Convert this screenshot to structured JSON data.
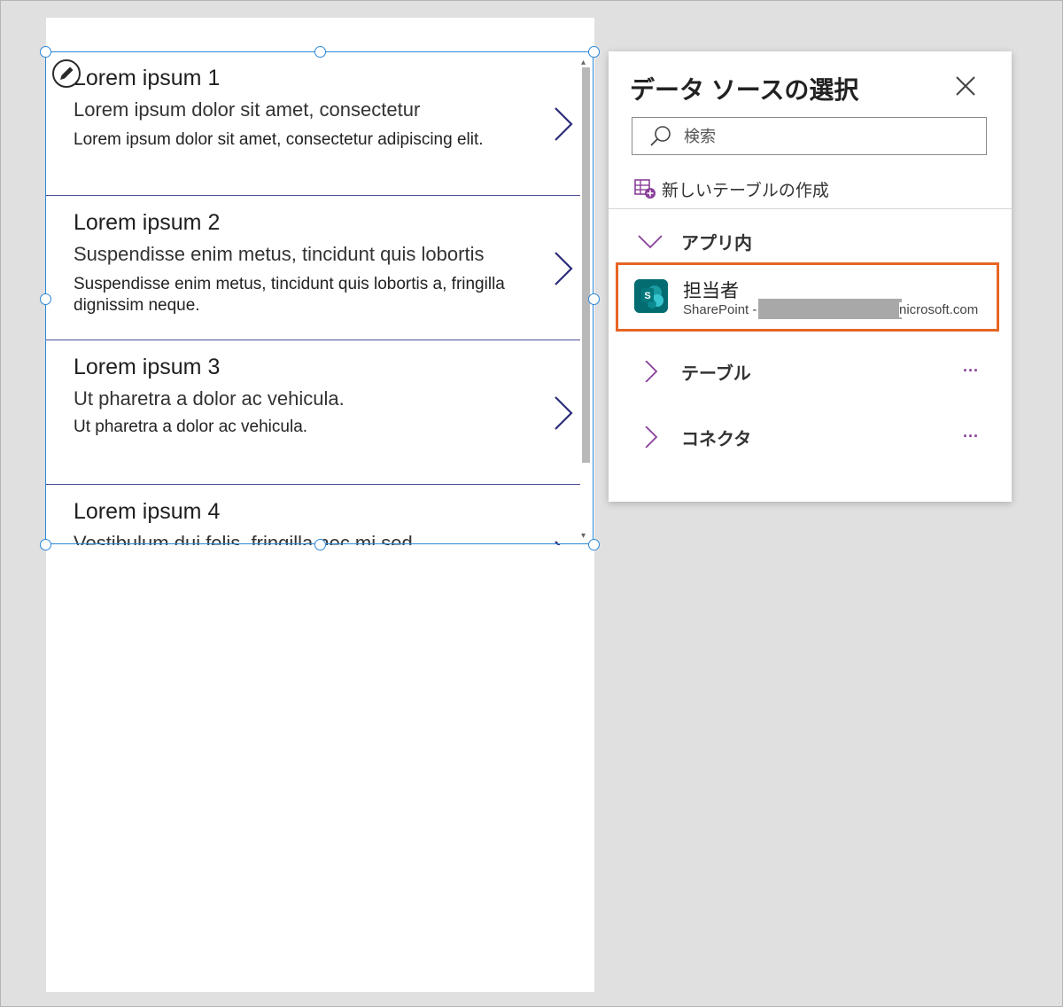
{
  "gallery": {
    "items": [
      {
        "title": "Lorem ipsum 1",
        "subtitle": "Lorem ipsum dolor sit amet, consectetur",
        "body": "Lorem ipsum dolor sit amet, consectetur adipiscing elit."
      },
      {
        "title": "Lorem ipsum 2",
        "subtitle": "Suspendisse enim metus, tincidunt quis lobortis",
        "body": "Suspendisse enim metus, tincidunt quis lobortis a, fringilla dignissim neque."
      },
      {
        "title": "Lorem ipsum 3",
        "subtitle": "Ut pharetra a dolor ac vehicula.",
        "body": "Ut pharetra a dolor ac vehicula."
      },
      {
        "title": "Lorem ipsum 4",
        "subtitle": "Vestibulum dui felis, fringilla nec mi sed",
        "body": ""
      }
    ]
  },
  "panel": {
    "title": "データ ソースの選択",
    "search_placeholder": "検索",
    "create_table_label": "新しいテーブルの作成",
    "sections": {
      "in_app": "アプリ内",
      "tables": "テーブル",
      "connectors": "コネクタ"
    },
    "more_label": "...",
    "data_source": {
      "name": "担当者",
      "description_prefix": "SharePoint -",
      "description_suffix": "nicrosoft.com"
    }
  },
  "colors": {
    "selection": "#2b88d8",
    "highlight": "#e86524",
    "sharepoint": "#036c70",
    "accent": "#8a3f9a"
  }
}
